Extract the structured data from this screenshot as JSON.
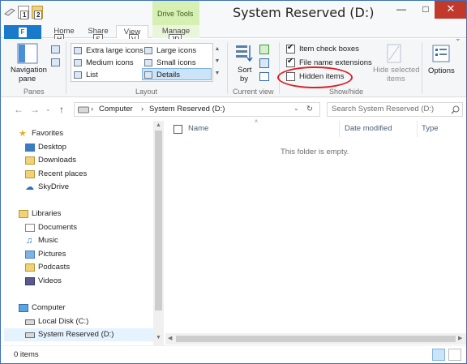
{
  "window": {
    "title": "System Reserved (D:)"
  },
  "qat": {
    "badge1": "1",
    "badge2": "2"
  },
  "tabs": {
    "file": "F",
    "home": "Home",
    "share": "Share",
    "view": "View",
    "manage": "Manage",
    "context_header": "Drive Tools",
    "keytip_home": "H",
    "keytip_share": "S",
    "keytip_view": "V",
    "keytip_manage": "JD"
  },
  "ribbon": {
    "panes": {
      "nav_pane_line1": "Navigation",
      "nav_pane_line2": "pane",
      "label": "Panes"
    },
    "layout": {
      "items": [
        "Extra large icons",
        "Large icons",
        "Medium icons",
        "Small icons",
        "List",
        "Details"
      ],
      "selected": "Details",
      "label": "Layout"
    },
    "current_view": {
      "sort_line1": "Sort",
      "sort_line2": "by",
      "label": "Current view"
    },
    "show_hide": {
      "item_check_boxes": "Item check boxes",
      "file_name_extensions": "File name extensions",
      "hidden_items": "Hidden items",
      "hide_selected_line1": "Hide selected",
      "hide_selected_line2": "items",
      "label": "Show/hide",
      "item_check_boxes_checked": true,
      "file_name_extensions_checked": true,
      "hidden_items_checked": false
    },
    "options": {
      "label": "Options"
    }
  },
  "address": {
    "computer": "Computer",
    "current": "System Reserved (D:)",
    "search_placeholder": "Search System Reserved (D:)"
  },
  "nav": {
    "favorites": "Favorites",
    "desktop": "Desktop",
    "downloads": "Downloads",
    "recent": "Recent places",
    "skydrive": "SkyDrive",
    "libraries": "Libraries",
    "documents": "Documents",
    "music": "Music",
    "pictures": "Pictures",
    "podcasts": "Podcasts",
    "videos": "Videos",
    "computer": "Computer",
    "local_disk": "Local Disk (C:)",
    "system_reserved": "System Reserved (D:)"
  },
  "content": {
    "col_name": "Name",
    "col_date": "Date modified",
    "col_type": "Type",
    "empty": "This folder is empty."
  },
  "status": {
    "items": "0 items"
  },
  "colors": {
    "accent": "#1979ca",
    "context": "#d6efb3",
    "highlight": "#d8232a"
  }
}
